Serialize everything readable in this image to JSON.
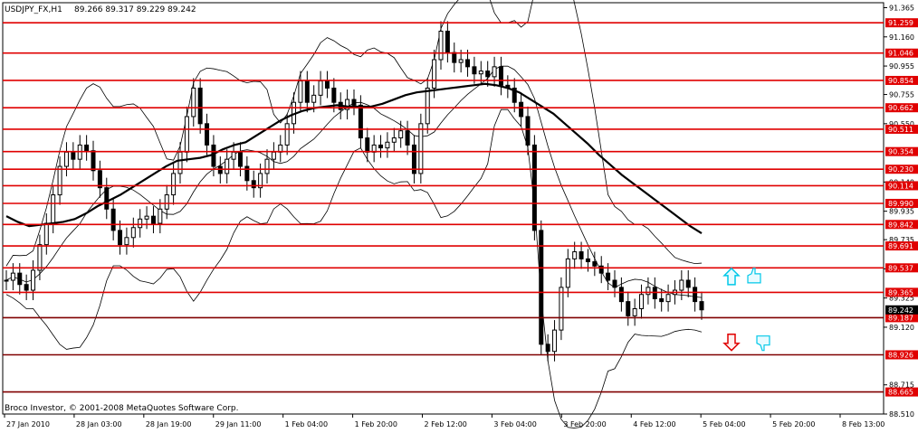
{
  "header": {
    "symbol": "USDJPY_FX,H1",
    "ohlc": "89.266 89.317 89.229 89.242"
  },
  "footer": {
    "copyright": "Broco Investor, © 2001-2008 MetaQuotes Software Corp."
  },
  "colors": {
    "level_line": "#e00000",
    "dark_level_line": "#800000",
    "price_tag": "#e00000",
    "current_tag": "#000000",
    "up_arrow": "#00c8e8",
    "down_arrow": "#e00000",
    "thumb_icon": "#00c8e8",
    "candle": "#000000",
    "band": "#000000"
  },
  "signals": [
    {
      "name": "up-arrow-icon",
      "direction": "up",
      "price": 89.47
    },
    {
      "name": "down-arrow-icon",
      "direction": "down",
      "price": 89.02
    }
  ],
  "chart_data": {
    "type": "candlestick",
    "symbol": "USDJPY_FX",
    "timeframe": "H1",
    "ylim": [
      88.51,
      91.4
    ],
    "y_ticks": [
      "91.365",
      "91.160",
      "90.955",
      "90.755",
      "90.550",
      "90.140",
      "89.935",
      "89.735",
      "89.530",
      "89.325",
      "89.120",
      "88.715",
      "88.510"
    ],
    "x_ticks": [
      "27 Jan 2010",
      "28 Jan 03:00",
      "28 Jan 19:00",
      "29 Jan 11:00",
      "1 Feb 04:00",
      "1 Feb 20:00",
      "2 Feb 12:00",
      "3 Feb 04:00",
      "3 Feb 20:00",
      "4 Feb 12:00",
      "5 Feb 04:00",
      "5 Feb 20:00",
      "8 Feb 13:00"
    ],
    "horizontal_levels": [
      {
        "price": 91.259,
        "label": "91.259",
        "style": "red"
      },
      {
        "price": 91.046,
        "label": "91.046",
        "style": "red"
      },
      {
        "price": 90.854,
        "label": "90.854",
        "style": "red"
      },
      {
        "price": 90.662,
        "label": "90.662",
        "style": "red"
      },
      {
        "price": 90.511,
        "label": "90.511",
        "style": "red"
      },
      {
        "price": 90.354,
        "label": "90.354",
        "style": "red"
      },
      {
        "price": 90.23,
        "label": "90.230",
        "style": "red"
      },
      {
        "price": 90.114,
        "label": "90.114",
        "style": "red"
      },
      {
        "price": 89.99,
        "label": "89.990",
        "style": "red"
      },
      {
        "price": 89.842,
        "label": "89.842",
        "style": "red"
      },
      {
        "price": 89.691,
        "label": "89.691",
        "style": "red"
      },
      {
        "price": 89.537,
        "label": "89.537",
        "style": "red"
      },
      {
        "price": 89.365,
        "label": "89.365",
        "style": "red"
      },
      {
        "price": 89.187,
        "label": "89.187",
        "style": "dark"
      },
      {
        "price": 88.926,
        "label": "88.926",
        "style": "dark"
      },
      {
        "price": 88.665,
        "label": "88.665",
        "style": "dark"
      }
    ],
    "current_price": {
      "price": 89.242,
      "label": "89.242"
    },
    "close_series": [
      89.45,
      89.5,
      89.42,
      89.38,
      89.52,
      89.7,
      89.85,
      90.05,
      90.25,
      90.35,
      90.3,
      90.4,
      90.36,
      90.22,
      90.1,
      89.95,
      89.8,
      89.7,
      89.75,
      89.82,
      89.88,
      89.9,
      89.85,
      89.95,
      90.05,
      90.2,
      90.35,
      90.6,
      90.8,
      90.55,
      90.4,
      90.25,
      90.2,
      90.3,
      90.35,
      90.25,
      90.15,
      90.1,
      90.2,
      90.3,
      90.35,
      90.4,
      90.55,
      90.7,
      90.85,
      90.7,
      90.75,
      90.85,
      90.8,
      90.7,
      90.65,
      90.72,
      90.68,
      90.45,
      90.35,
      90.4,
      90.38,
      90.42,
      90.45,
      90.5,
      90.4,
      90.2,
      90.55,
      90.8,
      91.0,
      91.2,
      91.05,
      90.98,
      91.0,
      90.95,
      90.9,
      90.92,
      90.88,
      90.95,
      90.82,
      90.8,
      90.7,
      90.6,
      90.4,
      89.8,
      89.0,
      88.95,
      89.1,
      89.4,
      89.6,
      89.65,
      89.6,
      89.58,
      89.55,
      89.5,
      89.45,
      89.4,
      89.3,
      89.2,
      89.25,
      89.35,
      89.4,
      89.32,
      89.3,
      89.35,
      89.38,
      89.45,
      89.4,
      89.3,
      89.242
    ],
    "ma_series": [
      89.9,
      89.86,
      89.83,
      89.84,
      89.85,
      89.86,
      89.88,
      89.92,
      89.97,
      90.01,
      90.05,
      90.1,
      90.15,
      90.2,
      90.25,
      90.29,
      90.3,
      90.31,
      90.33,
      90.37,
      90.4,
      90.42,
      90.47,
      90.52,
      90.57,
      90.61,
      90.64,
      90.66,
      90.67,
      90.68,
      90.67,
      90.67,
      90.67,
      90.69,
      90.72,
      90.75,
      90.77,
      90.78,
      90.79,
      90.8,
      90.81,
      90.82,
      90.83,
      90.82,
      90.8,
      90.77,
      90.72,
      90.67,
      90.62,
      90.55,
      90.48,
      90.41,
      90.33,
      90.26,
      90.19,
      90.13,
      90.07,
      90.01,
      89.95,
      89.89,
      89.83,
      89.78
    ]
  }
}
